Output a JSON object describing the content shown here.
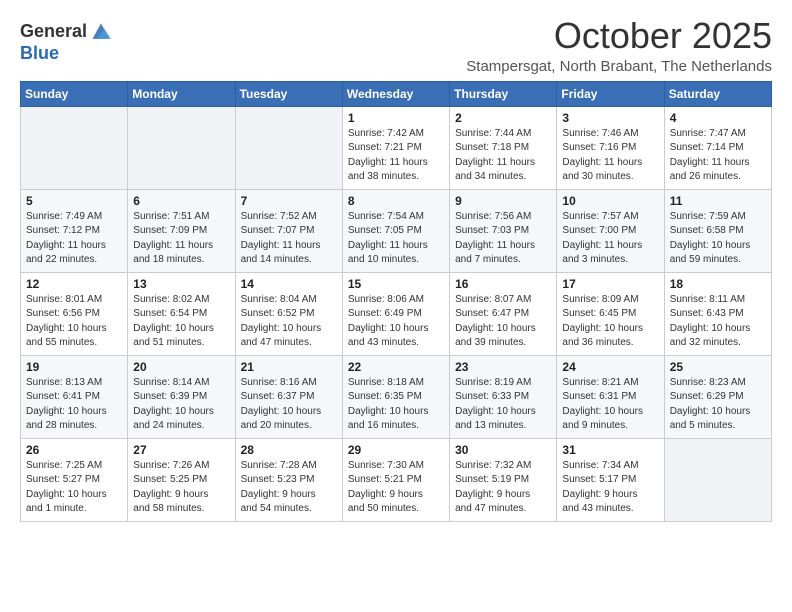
{
  "logo": {
    "line1": "General",
    "line2": "Blue"
  },
  "header": {
    "month": "October 2025",
    "location": "Stampersgat, North Brabant, The Netherlands"
  },
  "weekdays": [
    "Sunday",
    "Monday",
    "Tuesday",
    "Wednesday",
    "Thursday",
    "Friday",
    "Saturday"
  ],
  "weeks": [
    [
      {
        "day": "",
        "info": ""
      },
      {
        "day": "",
        "info": ""
      },
      {
        "day": "",
        "info": ""
      },
      {
        "day": "1",
        "info": "Sunrise: 7:42 AM\nSunset: 7:21 PM\nDaylight: 11 hours\nand 38 minutes."
      },
      {
        "day": "2",
        "info": "Sunrise: 7:44 AM\nSunset: 7:18 PM\nDaylight: 11 hours\nand 34 minutes."
      },
      {
        "day": "3",
        "info": "Sunrise: 7:46 AM\nSunset: 7:16 PM\nDaylight: 11 hours\nand 30 minutes."
      },
      {
        "day": "4",
        "info": "Sunrise: 7:47 AM\nSunset: 7:14 PM\nDaylight: 11 hours\nand 26 minutes."
      }
    ],
    [
      {
        "day": "5",
        "info": "Sunrise: 7:49 AM\nSunset: 7:12 PM\nDaylight: 11 hours\nand 22 minutes."
      },
      {
        "day": "6",
        "info": "Sunrise: 7:51 AM\nSunset: 7:09 PM\nDaylight: 11 hours\nand 18 minutes."
      },
      {
        "day": "7",
        "info": "Sunrise: 7:52 AM\nSunset: 7:07 PM\nDaylight: 11 hours\nand 14 minutes."
      },
      {
        "day": "8",
        "info": "Sunrise: 7:54 AM\nSunset: 7:05 PM\nDaylight: 11 hours\nand 10 minutes."
      },
      {
        "day": "9",
        "info": "Sunrise: 7:56 AM\nSunset: 7:03 PM\nDaylight: 11 hours\nand 7 minutes."
      },
      {
        "day": "10",
        "info": "Sunrise: 7:57 AM\nSunset: 7:00 PM\nDaylight: 11 hours\nand 3 minutes."
      },
      {
        "day": "11",
        "info": "Sunrise: 7:59 AM\nSunset: 6:58 PM\nDaylight: 10 hours\nand 59 minutes."
      }
    ],
    [
      {
        "day": "12",
        "info": "Sunrise: 8:01 AM\nSunset: 6:56 PM\nDaylight: 10 hours\nand 55 minutes."
      },
      {
        "day": "13",
        "info": "Sunrise: 8:02 AM\nSunset: 6:54 PM\nDaylight: 10 hours\nand 51 minutes."
      },
      {
        "day": "14",
        "info": "Sunrise: 8:04 AM\nSunset: 6:52 PM\nDaylight: 10 hours\nand 47 minutes."
      },
      {
        "day": "15",
        "info": "Sunrise: 8:06 AM\nSunset: 6:49 PM\nDaylight: 10 hours\nand 43 minutes."
      },
      {
        "day": "16",
        "info": "Sunrise: 8:07 AM\nSunset: 6:47 PM\nDaylight: 10 hours\nand 39 minutes."
      },
      {
        "day": "17",
        "info": "Sunrise: 8:09 AM\nSunset: 6:45 PM\nDaylight: 10 hours\nand 36 minutes."
      },
      {
        "day": "18",
        "info": "Sunrise: 8:11 AM\nSunset: 6:43 PM\nDaylight: 10 hours\nand 32 minutes."
      }
    ],
    [
      {
        "day": "19",
        "info": "Sunrise: 8:13 AM\nSunset: 6:41 PM\nDaylight: 10 hours\nand 28 minutes."
      },
      {
        "day": "20",
        "info": "Sunrise: 8:14 AM\nSunset: 6:39 PM\nDaylight: 10 hours\nand 24 minutes."
      },
      {
        "day": "21",
        "info": "Sunrise: 8:16 AM\nSunset: 6:37 PM\nDaylight: 10 hours\nand 20 minutes."
      },
      {
        "day": "22",
        "info": "Sunrise: 8:18 AM\nSunset: 6:35 PM\nDaylight: 10 hours\nand 16 minutes."
      },
      {
        "day": "23",
        "info": "Sunrise: 8:19 AM\nSunset: 6:33 PM\nDaylight: 10 hours\nand 13 minutes."
      },
      {
        "day": "24",
        "info": "Sunrise: 8:21 AM\nSunset: 6:31 PM\nDaylight: 10 hours\nand 9 minutes."
      },
      {
        "day": "25",
        "info": "Sunrise: 8:23 AM\nSunset: 6:29 PM\nDaylight: 10 hours\nand 5 minutes."
      }
    ],
    [
      {
        "day": "26",
        "info": "Sunrise: 7:25 AM\nSunset: 5:27 PM\nDaylight: 10 hours\nand 1 minute."
      },
      {
        "day": "27",
        "info": "Sunrise: 7:26 AM\nSunset: 5:25 PM\nDaylight: 9 hours\nand 58 minutes."
      },
      {
        "day": "28",
        "info": "Sunrise: 7:28 AM\nSunset: 5:23 PM\nDaylight: 9 hours\nand 54 minutes."
      },
      {
        "day": "29",
        "info": "Sunrise: 7:30 AM\nSunset: 5:21 PM\nDaylight: 9 hours\nand 50 minutes."
      },
      {
        "day": "30",
        "info": "Sunrise: 7:32 AM\nSunset: 5:19 PM\nDaylight: 9 hours\nand 47 minutes."
      },
      {
        "day": "31",
        "info": "Sunrise: 7:34 AM\nSunset: 5:17 PM\nDaylight: 9 hours\nand 43 minutes."
      },
      {
        "day": "",
        "info": ""
      }
    ]
  ]
}
